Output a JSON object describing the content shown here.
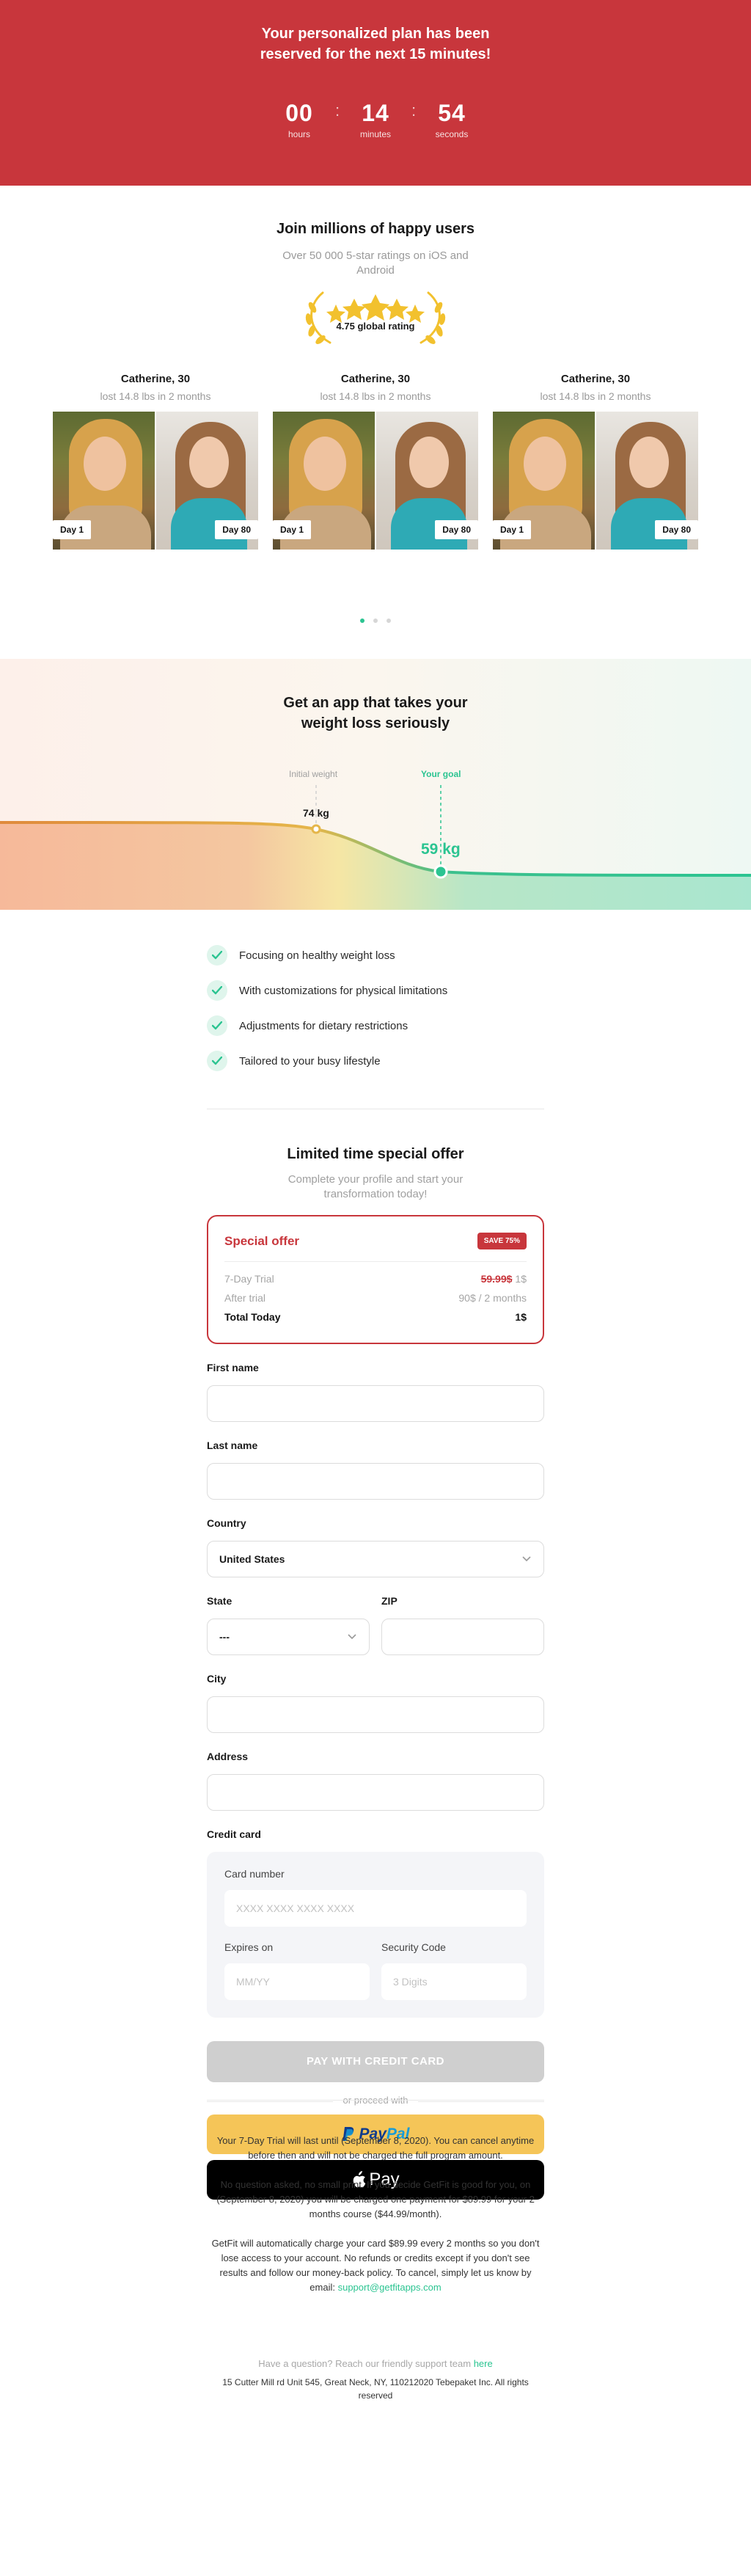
{
  "colors": {
    "accent": "#c8363c",
    "success": "#2bc491",
    "paypal": "#f5c558"
  },
  "hero": {
    "title": "Your personalized plan has been reserved for the next 15 minutes!",
    "timer": [
      {
        "value": "00",
        "label": "hours"
      },
      {
        "value": "14",
        "label": "minutes"
      },
      {
        "value": "54",
        "label": "seconds"
      }
    ],
    "separator": ":"
  },
  "proof": {
    "title": "Join millions of happy users",
    "subtitle": "Over 50 000 5-star ratings on iOS and Android",
    "rating": "4.75 global rating",
    "stars": 5,
    "testimonials": [
      {
        "name": "Catherine, 30",
        "loss": "lost 14.8 lbs in 2 months",
        "before": "Day 1",
        "after": "Day 80"
      },
      {
        "name": "Catherine, 30",
        "loss": "lost 14.8 lbs in 2 months",
        "before": "Day 1",
        "after": "Day 80"
      },
      {
        "name": "Catherine, 30",
        "loss": "lost 14.8 lbs in 2 months",
        "before": "Day 1",
        "after": "Day 80"
      }
    ],
    "active_slide": 1,
    "slide_count": 3
  },
  "graph": {
    "title": "Get an app that takes your weight loss seriously",
    "initial_label": "Initial weight",
    "goal_label": "Your goal",
    "initial_value": "74 kg",
    "goal_value": "59 kg"
  },
  "features": [
    "Focusing on healthy weight loss",
    "With customizations for physical limitations",
    "Adjustments for dietary restrictions",
    "Tailored to your busy lifestyle"
  ],
  "offer": {
    "title": "Limited time special offer",
    "subtitle": "Complete your profile and start your transformation today!",
    "box": {
      "name": "Special offer",
      "badge": "SAVE 75%",
      "trial_label": "7-Day Trial",
      "trial_old_price": "59.99$",
      "trial_price": "1$",
      "after_label": "After trial",
      "after_price": "90$ / 2 months",
      "total_label": "Total Today",
      "total_price": "1$"
    }
  },
  "form": {
    "first_name_label": "First name",
    "last_name_label": "Last name",
    "country_label": "Country",
    "country_value": "United States",
    "state_label": "State",
    "state_value": "---",
    "zip_label": "ZIP",
    "city_label": "City",
    "address_label": "Address",
    "credit_card_label": "Credit card",
    "card_number_label": "Card number",
    "card_number_placeholder": "XXXX XXXX XXXX XXXX",
    "expires_label": "Expires on",
    "expires_placeholder": "MM/YY",
    "cvc_label": "Security Code",
    "cvc_placeholder": "3 Digits",
    "pay_button": "PAY WITH CREDIT CARD",
    "or_text": "or proceed with",
    "paypal_part1": "Pay",
    "paypal_part2": "Pal",
    "apple_pay": "Pay"
  },
  "footer": {
    "para1": "Your 7-Day Trial will last until (September 8, 2020). You can cancel anytime before then and will not be charged the full program amount.",
    "para2": "No question asked, no small print. If you decide GetFit is good for you, on (September 8, 2020) you will be charged one payment for $89.99 for your 2 months course ($44.99/month).",
    "para3": "GetFit will automatically charge your card $89.99 every 2 months so you don't lose access to your account. No refunds or credits except if you don't see results and follow our money-back policy. To cancel, simply let us know by email:",
    "email": "support@getfitapps.com",
    "support_text": "Have a question? Reach our friendly support team",
    "support_link": "here",
    "address": "15 Cutter Mill rd Unit 545, Great Neck, NY, 110212020 Tebepaket Inc. All rights reserved"
  }
}
